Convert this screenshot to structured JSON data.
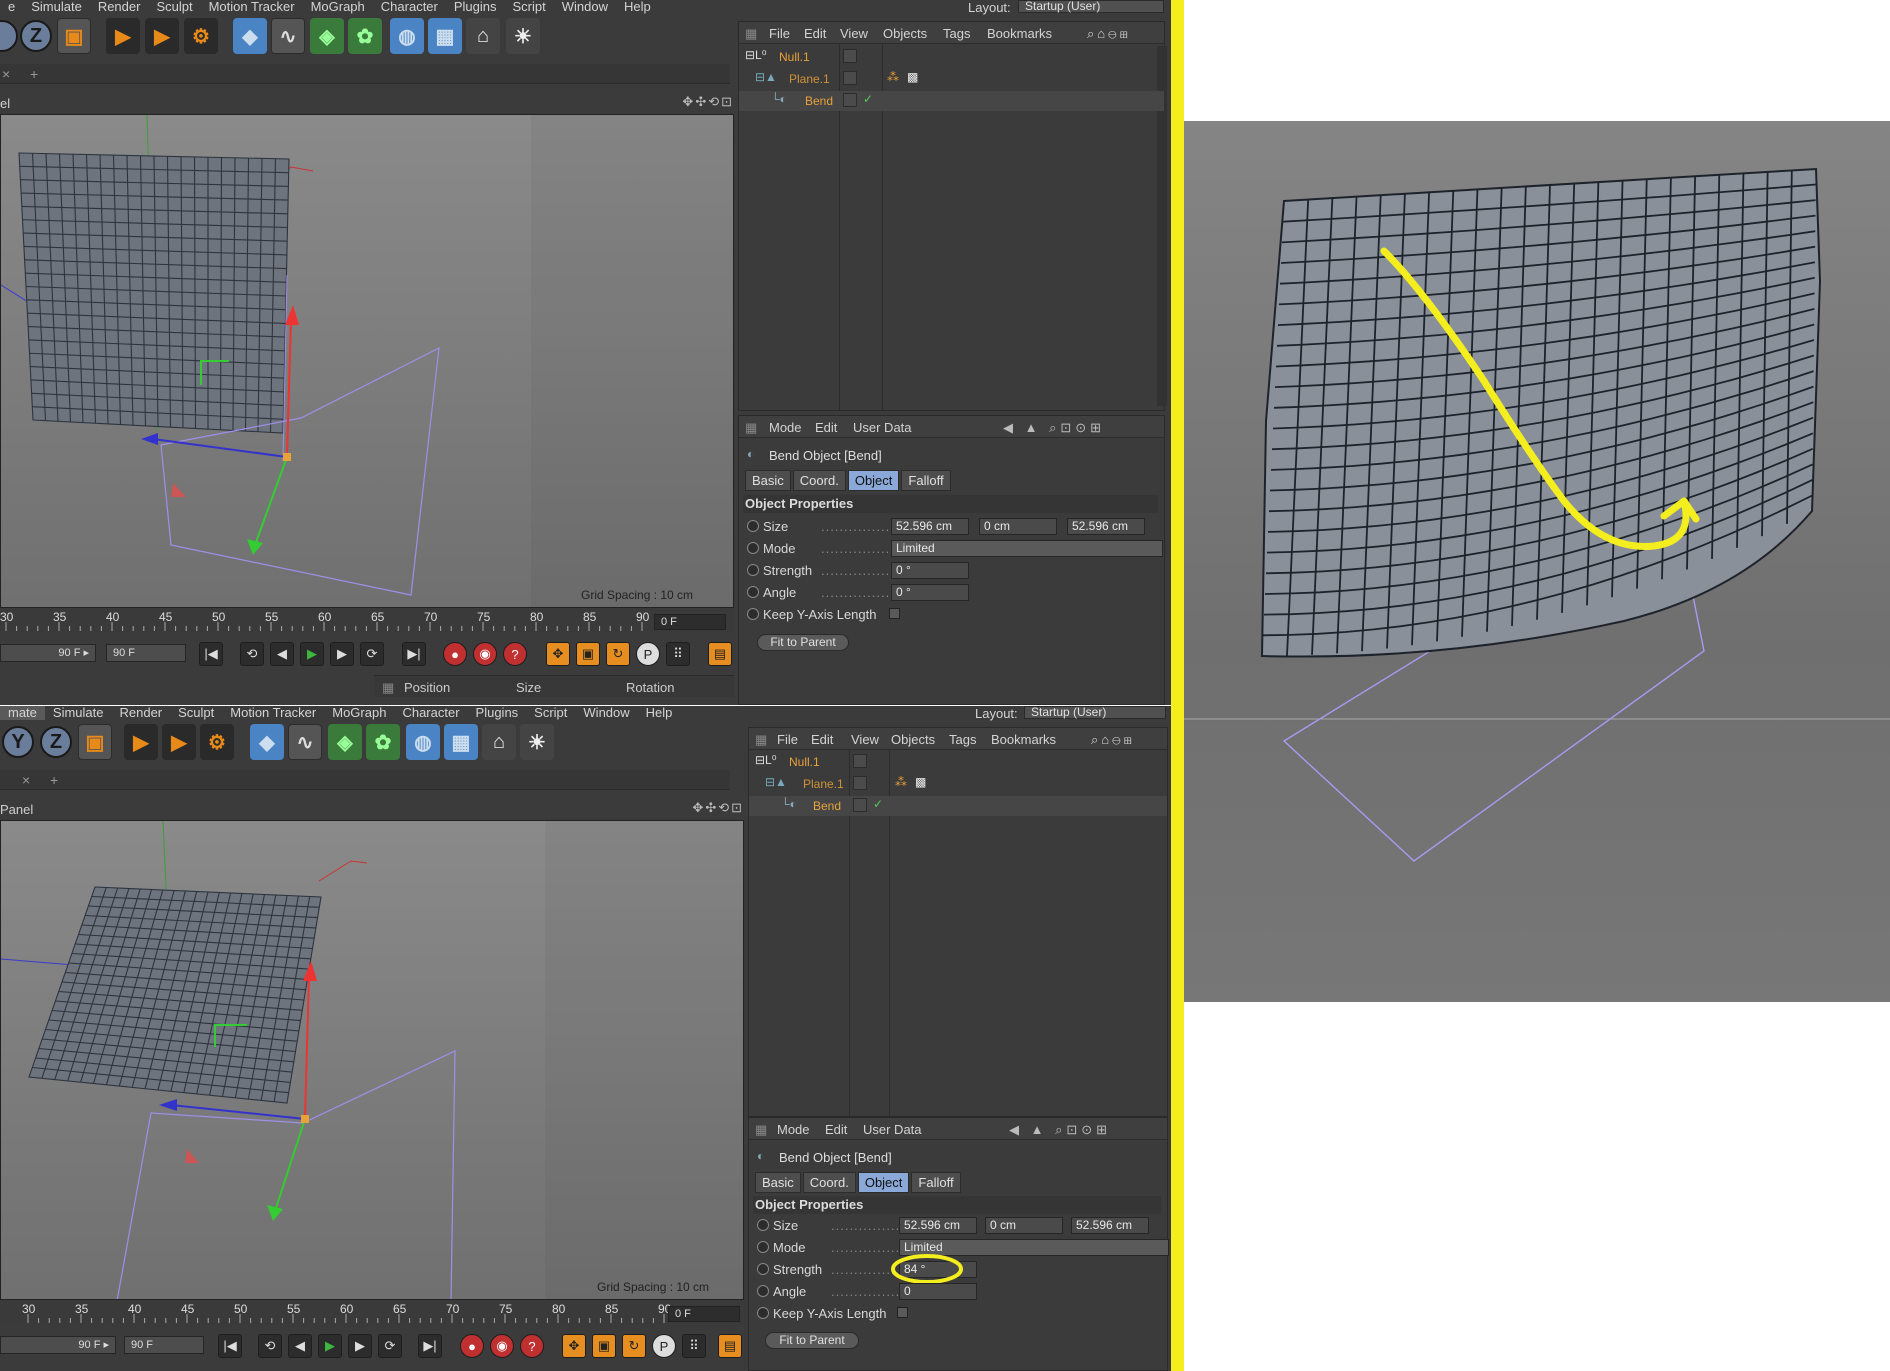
{
  "top": {
    "menu": [
      "e",
      "Simulate",
      "Render",
      "Sculpt",
      "Motion Tracker",
      "MoGraph",
      "Character",
      "Plugins",
      "Script",
      "Window",
      "Help"
    ],
    "layout_label": "Layout:",
    "layout_value": "Startup (User)",
    "viewport_label": "el",
    "grid_spacing": "Grid Spacing : 10 cm",
    "timeline_ticks": [
      "30",
      "35",
      "40",
      "45",
      "50",
      "55",
      "60",
      "65",
      "70",
      "75",
      "80",
      "85",
      "90"
    ],
    "current_frame": "0 F",
    "end_frame_a": "90 F ▸",
    "end_frame_b": "90 F",
    "coord_headers": [
      "Position",
      "Size",
      "Rotation"
    ],
    "object_manager": {
      "menu": [
        "File",
        "Edit",
        "View",
        "Objects",
        "Tags",
        "Bookmarks"
      ],
      "objects": [
        {
          "name": "Null.1"
        },
        {
          "name": "Plane.1"
        },
        {
          "name": "Bend"
        }
      ]
    },
    "attribute_manager": {
      "menu": [
        "Mode",
        "Edit",
        "User Data"
      ],
      "title": "Bend Object [Bend]",
      "tabs": [
        "Basic",
        "Coord.",
        "Object",
        "Falloff"
      ],
      "active_tab": "Object",
      "section": "Object Properties",
      "size_label": "Size",
      "size_values": [
        "52.596 cm",
        "0 cm",
        "52.596 cm"
      ],
      "mode_label": "Mode",
      "mode_value": "Limited",
      "strength_label": "Strength",
      "strength_value": "0 °",
      "angle_label": "Angle",
      "angle_value": "0 °",
      "keep_label": "Keep Y-Axis Length",
      "fit_button": "Fit to Parent"
    }
  },
  "bottom": {
    "menu": [
      "mate",
      "Simulate",
      "Render",
      "Sculpt",
      "Motion Tracker",
      "MoGraph",
      "Character",
      "Plugins",
      "Script",
      "Window",
      "Help"
    ],
    "layout_label": "Layout:",
    "layout_value": "Startup (User)",
    "viewport_label": "Panel",
    "grid_spacing": "Grid Spacing : 10 cm",
    "timeline_ticks": [
      "30",
      "35",
      "40",
      "45",
      "50",
      "55",
      "60",
      "65",
      "70",
      "75",
      "80",
      "85",
      "90"
    ],
    "current_frame": "0 F",
    "end_frame_a": "90 F ▸",
    "end_frame_b": "90 F",
    "object_manager": {
      "menu": [
        "File",
        "Edit",
        "View",
        "Objects",
        "Tags",
        "Bookmarks"
      ],
      "objects": [
        {
          "name": "Null.1"
        },
        {
          "name": "Plane.1"
        },
        {
          "name": "Bend"
        }
      ]
    },
    "attribute_manager": {
      "menu": [
        "Mode",
        "Edit",
        "User Data"
      ],
      "title": "Bend Object [Bend]",
      "tabs": [
        "Basic",
        "Coord.",
        "Object",
        "Falloff"
      ],
      "active_tab": "Object",
      "section": "Object Properties",
      "size_label": "Size",
      "size_values": [
        "52.596 cm",
        "0 cm",
        "52.596 cm"
      ],
      "mode_label": "Mode",
      "mode_value": "Limited",
      "strength_label": "Strength",
      "strength_value": "84 °",
      "angle_label": "Angle",
      "angle_value": "0",
      "keep_label": "Keep Y-Axis Length",
      "fit_button": "Fit to Parent"
    }
  },
  "colors": {
    "highlight_yellow": "#f4ee1e",
    "object_orange": "#e8a23a",
    "active_tab_blue": "#8aa8d8",
    "bend_outline": "#9f8fe8"
  }
}
